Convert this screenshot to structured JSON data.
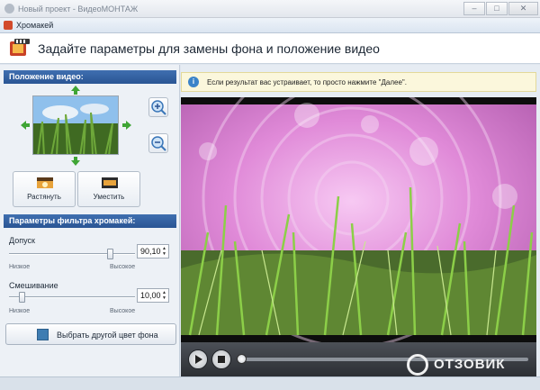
{
  "window": {
    "title": "Новый проект - ВидеоМОНТАЖ",
    "controls": [
      "–",
      "□",
      "✕"
    ]
  },
  "dialog": {
    "title": "Хромакей"
  },
  "header": {
    "text": "Задайте параметры для замены фона и положение видео"
  },
  "position_section": {
    "heading": "Положение видео:",
    "stretch_label": "Растянуть",
    "fit_label": "Уместить"
  },
  "filter_section": {
    "heading": "Параметры фильтра хромакей:",
    "tolerance": {
      "label": "Допуск",
      "value": "90,10",
      "level_fraction": 0.8,
      "low_label": "Низкое",
      "high_label": "Высокое"
    },
    "blend": {
      "label": "Смешивание",
      "value": "10,00",
      "level_fraction": 0.1,
      "low_label": "Низкое",
      "high_label": "Высокое"
    },
    "color_button_label": "Выбрать другой цвет фона",
    "color_swatch": "#3f7db2"
  },
  "info": {
    "icon": "i",
    "text": "Если результат вас устраивает, то просто нажмите \"Далее\"."
  },
  "player": {
    "progress_fraction": 0.0
  },
  "watermark": {
    "text": "ОТЗОВИК"
  },
  "colors": {
    "accent_header": "#2a5594",
    "chroma_pink": "#e08ad8"
  }
}
